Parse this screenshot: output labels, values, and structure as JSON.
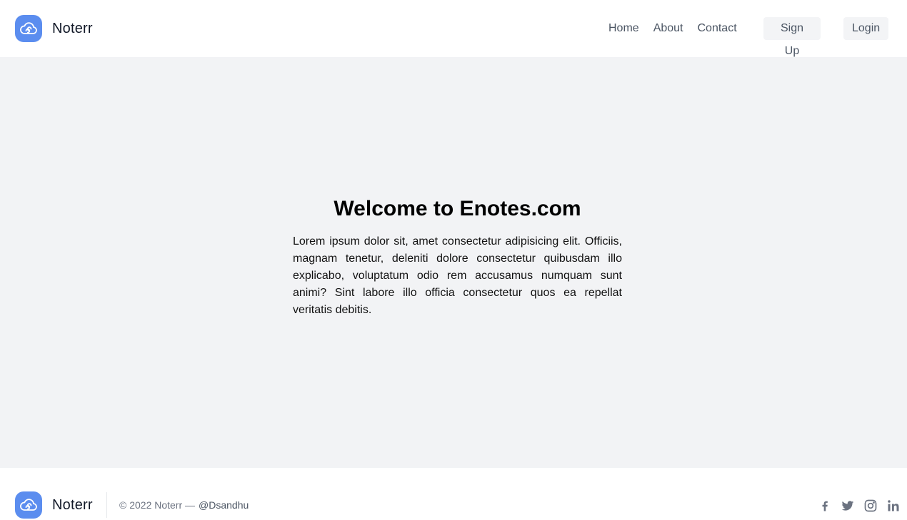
{
  "header": {
    "brand_name": "Noterr",
    "logo_icon": "cloud-icon",
    "nav": [
      {
        "label": "Home"
      },
      {
        "label": "About"
      },
      {
        "label": "Contact"
      }
    ],
    "signup_label": "Sign Up",
    "login_label": "Login"
  },
  "hero": {
    "title": "Welcome to Enotes.com",
    "body": "Lorem ipsum dolor sit, amet consectetur adipisicing elit. Officiis, magnam tenetur, deleniti dolore consectetur quibusdam illo explicabo, voluptatum odio rem accusamus numquam sunt animi? Sint labore illo officia consectetur quos ea repellat veritatis debitis."
  },
  "footer": {
    "brand_name": "Noterr",
    "copyright": "© 2022 Noterr —",
    "handle": "@Dsandhu",
    "socials": [
      {
        "icon": "facebook-icon"
      },
      {
        "icon": "twitter-icon"
      },
      {
        "icon": "instagram-icon"
      },
      {
        "icon": "linkedin-icon"
      }
    ]
  },
  "colors": {
    "accent": "#5b8def",
    "main_background": "#f2f3f5",
    "button_background": "#f3f4f6",
    "nav_text": "#4b5563",
    "social_icon": "#6b7280"
  }
}
